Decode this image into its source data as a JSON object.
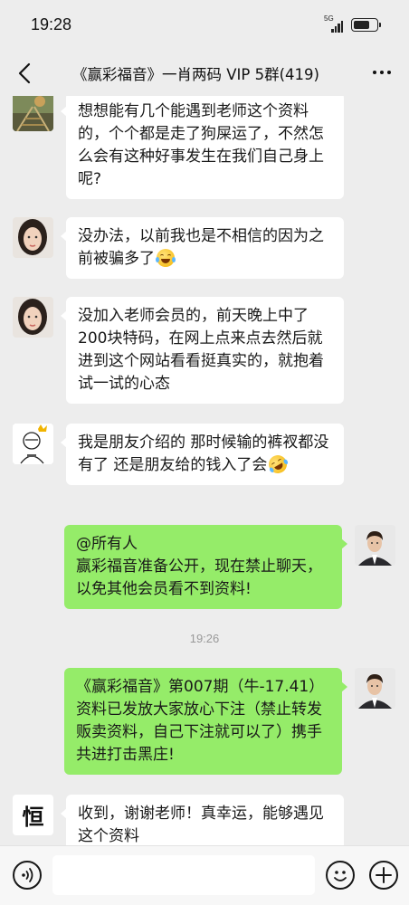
{
  "status_bar": {
    "time": "19:28",
    "network": "5G"
  },
  "header": {
    "title": "《赢彩福音》一肖两码 VIP 5群(419)"
  },
  "messages": [
    {
      "side": "left",
      "avatar": "railway-photo-avatar",
      "text": "想想能有几个能遇到老师这个资料的，个个都是走了狗屎运了，不然怎么会有这种好事发生在我们自己身上呢?"
    },
    {
      "side": "left",
      "avatar": "girl-photo-avatar",
      "text": "没办法，以前我也是不相信的因为之前被骗多了",
      "emoji": "laughing-tears-emoji"
    },
    {
      "side": "left",
      "avatar": "girl-photo-avatar",
      "text": "没加入老师会员的，前天晚上中了200块特码，在网上点来点去然后就进到这个网站看看挺真实的，就抱着试一试的心态"
    },
    {
      "side": "left",
      "avatar": "cartoon-sketch-avatar",
      "text": "我是朋友介绍的 那时候输的裤衩都没有了 还是朋友给的钱入了会",
      "emoji": "rolling-laughing-emoji"
    },
    {
      "side": "right",
      "avatar": "man-suit-avatar",
      "text_lines": [
        "@所有人",
        "赢彩福音准备公开，现在禁止聊天，以免其他会员看不到资料!"
      ]
    },
    {
      "type": "timestamp",
      "text": "19:26"
    },
    {
      "side": "right",
      "avatar": "man-suit-avatar",
      "text": "《赢彩福音》第007期（牛-17.41）资料已发放大家放心下注（禁止转发贩卖资料，自己下注就可以了）携手共进打击黑庄!"
    },
    {
      "side": "left",
      "avatar": "calligraphy-avatar",
      "avatar_char": "恒",
      "text": "收到，谢谢老师！真幸运，能够遇见这个资料"
    }
  ],
  "input_bar": {
    "input_value": "",
    "voice_icon": "voice-icon",
    "emoji_icon": "emoji-icon",
    "plus_icon": "plus-icon"
  },
  "colors": {
    "background": "#ededed",
    "bubble_left": "#ffffff",
    "bubble_right": "#95ec69",
    "timestamp": "#999999"
  }
}
